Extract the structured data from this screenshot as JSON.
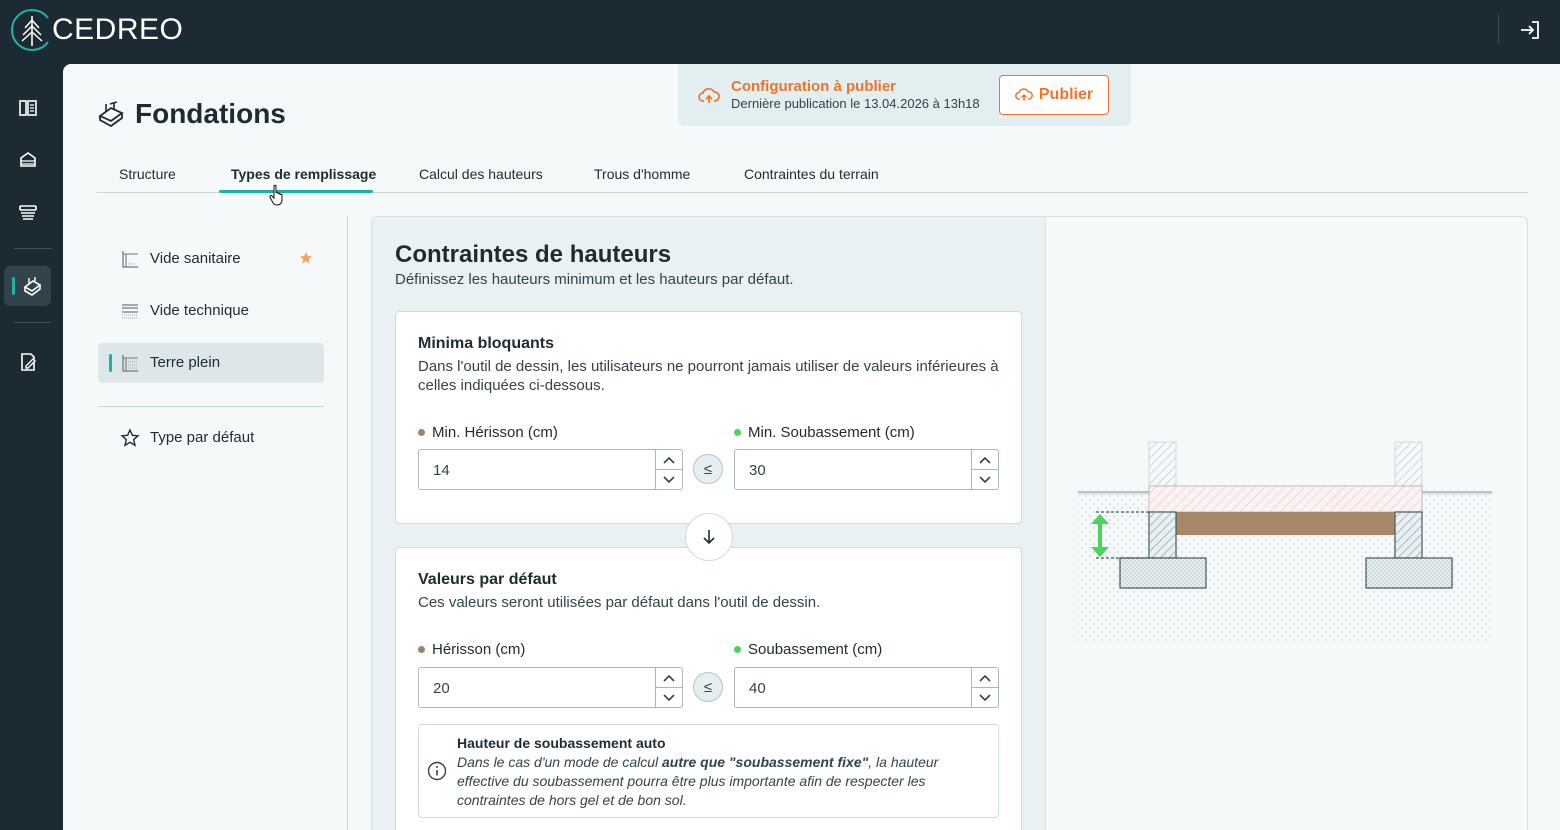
{
  "app": {
    "logo_text": "CEDREO"
  },
  "page": {
    "title": "Fondations"
  },
  "publish": {
    "title": "Configuration à publier",
    "subtitle": "Dernière publication le 13.04.2026 à 13h18",
    "button_label": "Publier"
  },
  "tabs": [
    {
      "label": "Structure"
    },
    {
      "label": "Types de remplissage"
    },
    {
      "label": "Calcul des hauteurs"
    },
    {
      "label": "Trous d'homme"
    },
    {
      "label": "Contraintes du terrain"
    }
  ],
  "subnav": {
    "items": [
      {
        "label": "Vide sanitaire"
      },
      {
        "label": "Vide technique"
      },
      {
        "label": "Terre plein"
      }
    ],
    "default_type_label": "Type par défaut"
  },
  "section": {
    "title": "Contraintes de hauteurs",
    "description": "Définissez les hauteurs minimum et les hauteurs par défaut."
  },
  "minima": {
    "title": "Minima bloquants",
    "description": "Dans l'outil de dessin, les utilisateurs ne pourront jamais utiliser de valeurs inférieures à celles indiquées ci-dessous.",
    "herisson_label": "Min. Hérisson (cm)",
    "herisson_value": "14",
    "soubassement_label": "Min. Soubassement (cm)",
    "soubassement_value": "30",
    "leq": "≤"
  },
  "defaults": {
    "title": "Valeurs par défaut",
    "description": "Ces valeurs seront utilisées par défaut dans l'outil de dessin.",
    "herisson_label": "Hérisson (cm)",
    "herisson_value": "20",
    "soubassement_label": "Soubassement (cm)",
    "soubassement_value": "40",
    "leq": "≤"
  },
  "info": {
    "title": "Hauteur de soubassement auto",
    "text_1": "Dans le cas d'un mode de calcul ",
    "text_bold": "autre que \"soubassement fixe\"",
    "text_2": ", la hauteur effective du soubassement pourra être plus importante afin de respecter les contraintes de hors gel et de bon sol."
  },
  "colors": {
    "accent": "#21b0a8",
    "publish": "#e8772e",
    "herisson_dot": "#9b8570",
    "soubassement_dot": "#4cd35b",
    "sidebar_bg": "#1c2b33"
  },
  "icons": {
    "logo": "tree-logo-icon",
    "logout": "logout-icon",
    "nav": [
      "catalog-icon",
      "furniture-icon",
      "layers-icon",
      "foundation-icon",
      "edit-document-icon"
    ]
  }
}
